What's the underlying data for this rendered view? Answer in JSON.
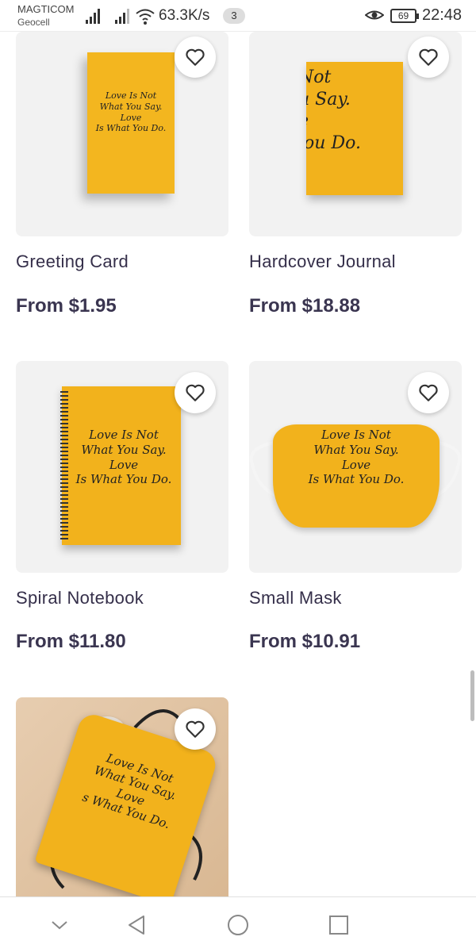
{
  "status_bar": {
    "carrier": "MAGTICOM",
    "carrier_sub": "Geocell",
    "speed": "63.3K/s",
    "notifications": "3",
    "battery": "69",
    "time": "22:48"
  },
  "products": [
    {
      "title": "Greeting Card",
      "price": "From $1.95",
      "image_text": [
        "Love Is Not",
        "What You Say.",
        "Love",
        "Is What You Do."
      ]
    },
    {
      "title": "Hardcover Journal",
      "price": "From $18.88",
      "image_text": [
        "Not",
        "u Say.",
        "e",
        "lou Do."
      ]
    },
    {
      "title": "Spiral Notebook",
      "price": "From $11.80",
      "image_text": [
        "Love Is Not",
        "What You Say.",
        "Love",
        "Is What You Do."
      ]
    },
    {
      "title": "Small Mask",
      "price": "From $10.91",
      "image_text": [
        "Love Is Not",
        "What You Say.",
        "Love",
        "Is What You Do."
      ]
    },
    {
      "title": "",
      "price": "",
      "image_text": [
        "Love Is Not",
        "What You Say.",
        "Love",
        "s What You Do."
      ]
    }
  ],
  "icons": {
    "favorite": "heart-outline-icon",
    "nav": [
      "chevron-down-icon",
      "back-triangle-icon",
      "home-circle-icon",
      "recents-square-icon"
    ]
  },
  "colors": {
    "product_yellow": "#f2b21c",
    "text_dark": "#352f4a",
    "thumb_bg": "#f2f2f2"
  }
}
